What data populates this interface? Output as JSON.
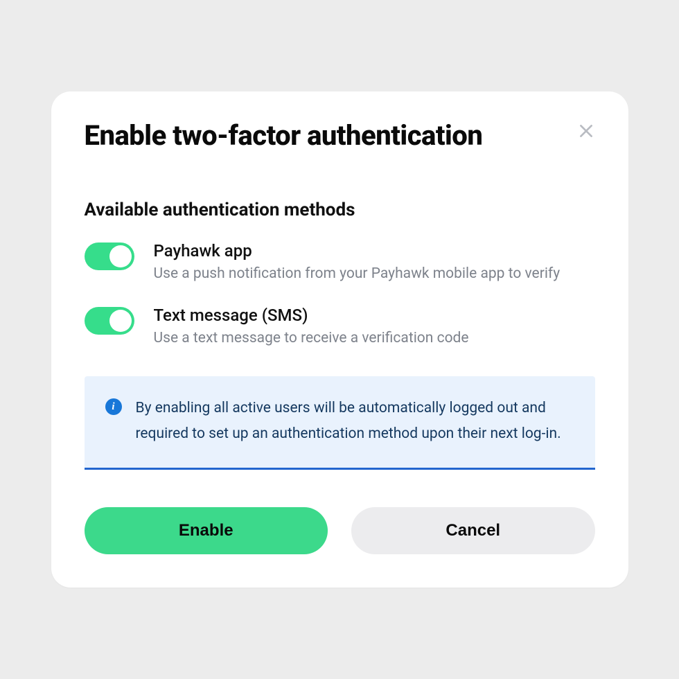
{
  "modal": {
    "title": "Enable two-factor authentication",
    "section_heading": "Available authentication methods",
    "methods": [
      {
        "title": "Payhawk app",
        "description": "Use a push notification from your Payhawk mobile app to verify",
        "enabled": true
      },
      {
        "title": "Text message (SMS)",
        "description": "Use a text message to receive a verification code",
        "enabled": true
      }
    ],
    "info_text": "By enabling all active users will be automatically logged out and required to set up an authentication method upon their next log-in.",
    "buttons": {
      "primary": "Enable",
      "secondary": "Cancel"
    }
  },
  "colors": {
    "accent_green": "#3cd98b",
    "toggle_on": "#36dd8b",
    "info_bg": "#e9f2fd",
    "info_border": "#2266cf",
    "info_text": "#14385f",
    "info_icon_bg": "#1877d8"
  }
}
